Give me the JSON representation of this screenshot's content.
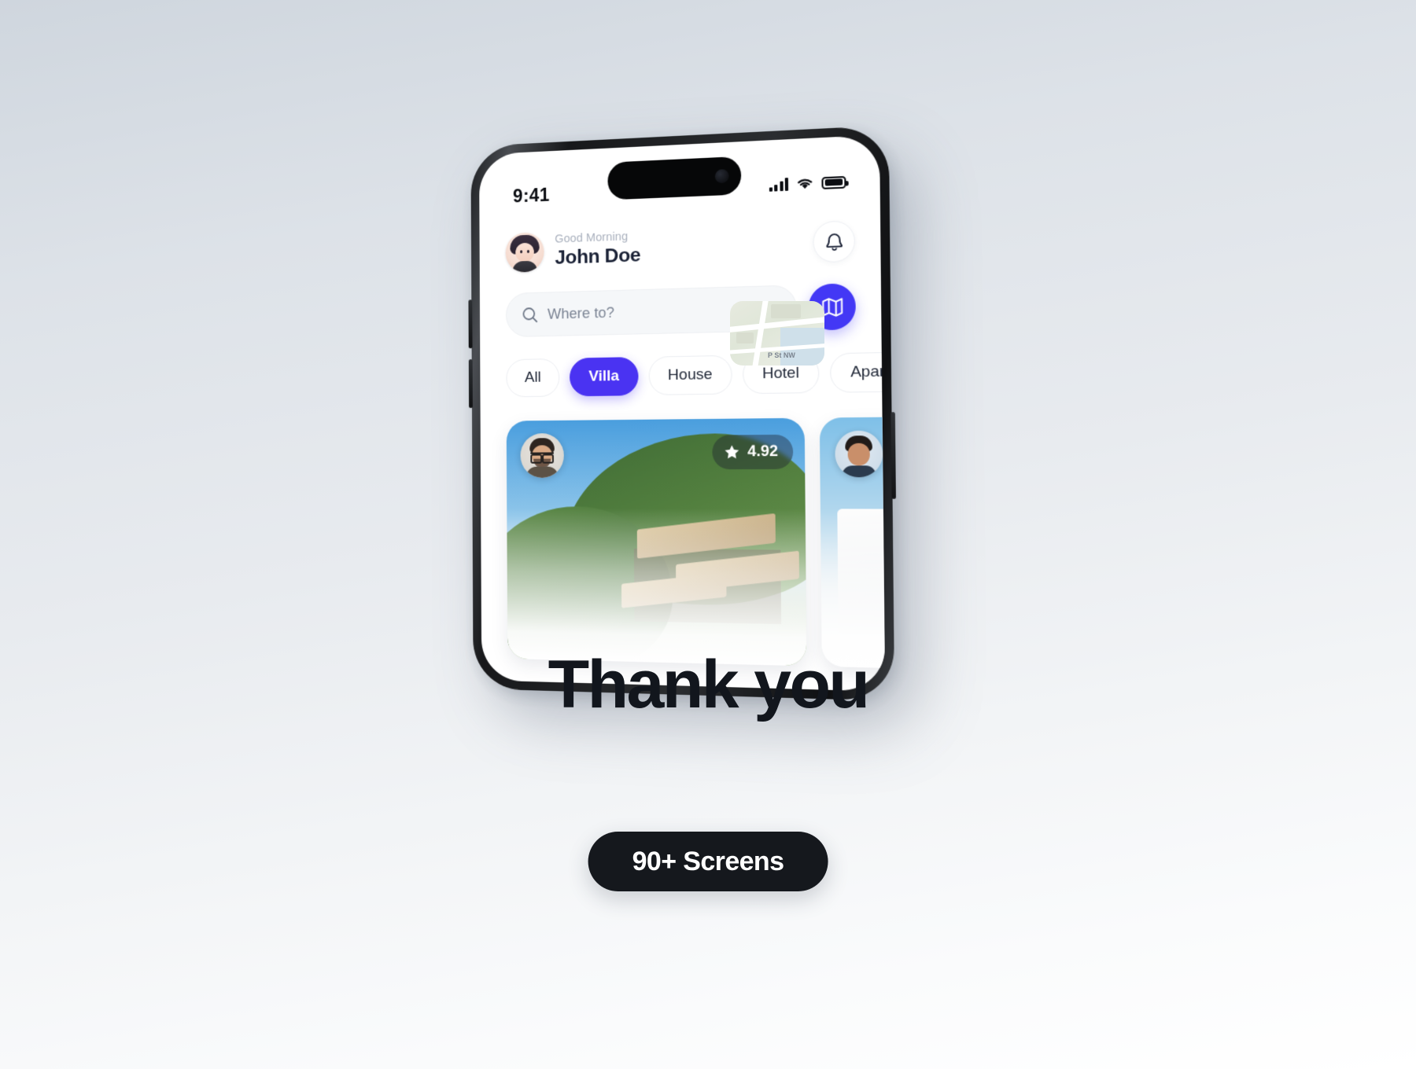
{
  "presentation": {
    "thank_you_text": "Thank you",
    "screens_pill_label": "90+ Screens",
    "background_colors": [
      "#cfd6de",
      "#ffffff"
    ]
  },
  "phone": {
    "status_bar": {
      "time": "9:41",
      "cellular_icon": "signal-bars-icon",
      "wifi_icon": "wifi-icon",
      "battery_icon": "battery-icon",
      "dynamic_island": "dynamic-island"
    },
    "app": {
      "header": {
        "greeting": "Good Morning",
        "user_name": "John Doe",
        "avatar": "user-avatar",
        "notification_icon": "bell-icon"
      },
      "search": {
        "placeholder": "Where to?",
        "value": "",
        "search_icon": "search-icon",
        "map_button_icon": "map-icon",
        "map_button_color": "#4338f5",
        "map_thumbnail_label": "P St NW"
      },
      "filters": {
        "chips": [
          {
            "label": "All",
            "active": false
          },
          {
            "label": "Villa",
            "active": true
          },
          {
            "label": "House",
            "active": false
          },
          {
            "label": "Hotel",
            "active": false
          },
          {
            "label": "Apartment",
            "active": false
          }
        ],
        "active_color": "#4a33f2"
      },
      "listings": [
        {
          "host_avatar": "host-avatar",
          "rating": "4.92",
          "rating_icon": "star-icon",
          "image": "villa-hillside-photo"
        },
        {
          "host_avatar": "host-avatar",
          "image": "villa-white-building-photo"
        }
      ]
    }
  }
}
